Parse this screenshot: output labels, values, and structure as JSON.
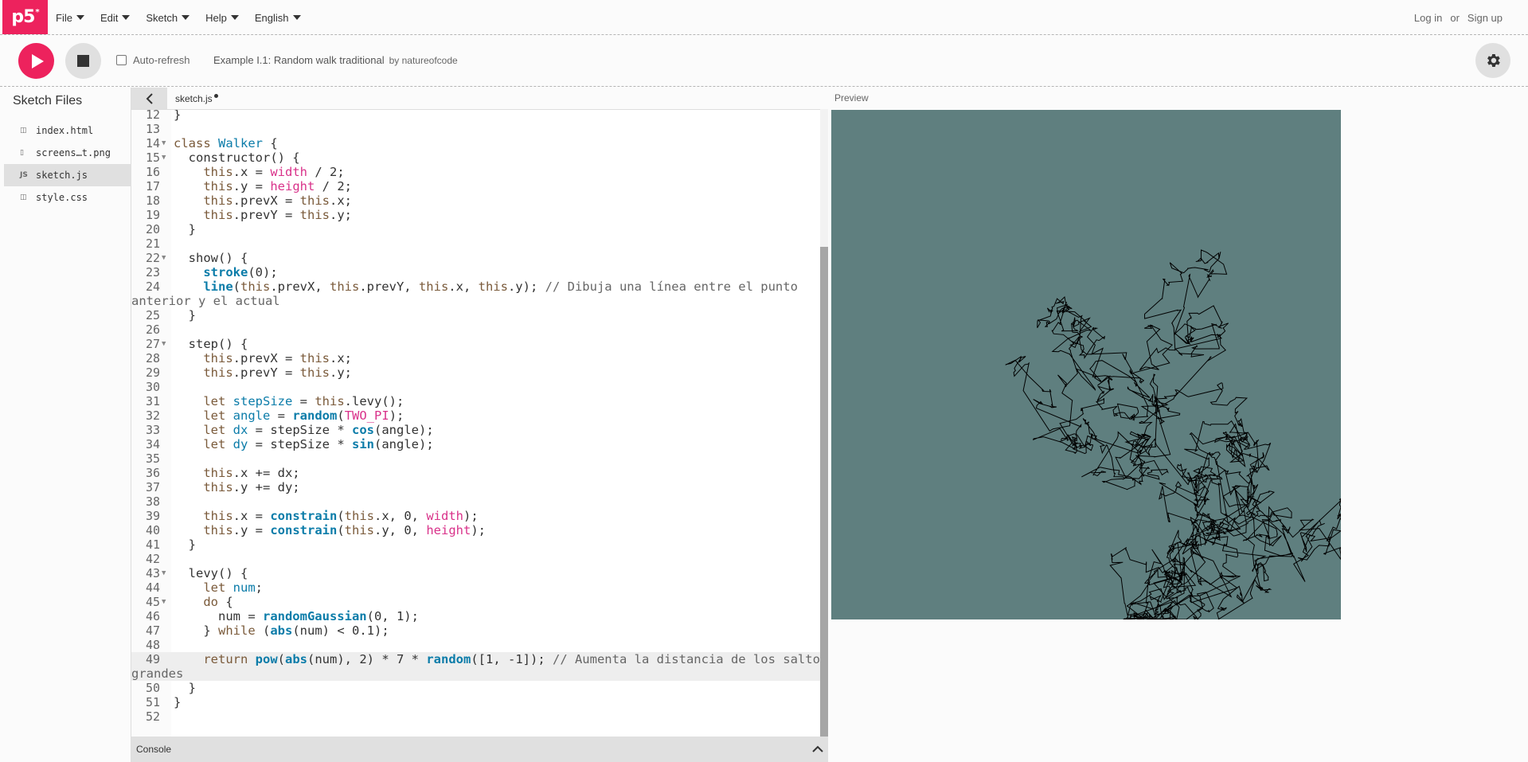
{
  "nav": {
    "logo": "p5",
    "logo_mark": "*",
    "menu": [
      {
        "label": "File"
      },
      {
        "label": "Edit"
      },
      {
        "label": "Sketch"
      },
      {
        "label": "Help"
      },
      {
        "label": "English"
      }
    ],
    "login": "Log in",
    "or": "or",
    "signup": "Sign up"
  },
  "toolbar": {
    "auto_refresh_label": "Auto-refresh",
    "auto_refresh_checked": false,
    "sketch_title": "Example I.1: Random walk traditional",
    "sketch_author": "by natureofcode"
  },
  "sidebar": {
    "title": "Sketch Files",
    "files": [
      {
        "name": "index.html",
        "icon": "html-file-icon",
        "glyph": "◫"
      },
      {
        "name": "screens…t.png",
        "icon": "image-file-icon",
        "glyph": "▯"
      },
      {
        "name": "sketch.js",
        "icon": "js-file-icon",
        "glyph": "JS",
        "active": true
      },
      {
        "name": "style.css",
        "icon": "css-file-icon",
        "glyph": "◫"
      }
    ]
  },
  "editor": {
    "tab": "sketch.js",
    "lines": [
      {
        "n": "12",
        "fold": "",
        "html": "}"
      },
      {
        "n": "13",
        "fold": "",
        "html": ""
      },
      {
        "n": "14",
        "fold": "▼",
        "html": "<span class='kw2'>class</span> <span class='cls'>Walker</span> {"
      },
      {
        "n": "15",
        "fold": "▼",
        "html": "  constructor() {"
      },
      {
        "n": "16",
        "fold": "",
        "html": "    <span class='th'>this</span>.x = <span class='p5v'>width</span> / 2;"
      },
      {
        "n": "17",
        "fold": "",
        "html": "    <span class='th'>this</span>.y = <span class='p5v'>height</span> / 2;"
      },
      {
        "n": "18",
        "fold": "",
        "html": "    <span class='th'>this</span>.prevX = <span class='th'>this</span>.x;"
      },
      {
        "n": "19",
        "fold": "",
        "html": "    <span class='th'>this</span>.prevY = <span class='th'>this</span>.y;"
      },
      {
        "n": "20",
        "fold": "",
        "html": "  }"
      },
      {
        "n": "21",
        "fold": "",
        "html": ""
      },
      {
        "n": "22",
        "fold": "▼",
        "html": "  show() {"
      },
      {
        "n": "23",
        "fold": "",
        "html": "    <span class='fn'>stroke</span>(0);"
      },
      {
        "n": "24",
        "fold": "",
        "html": "    <span class='fn'>line</span>(<span class='th'>this</span>.prevX, <span class='th'>this</span>.prevY, <span class='th'>this</span>.x, <span class='th'>this</span>.y); <span class='cm'>// Dibuja una línea entre el punto</span>"
      },
      {
        "n": "",
        "fold": "",
        "html": "<span class='cm' style='margin-left:-53px'>anterior y el actual</span>"
      },
      {
        "n": "25",
        "fold": "",
        "html": "  }"
      },
      {
        "n": "26",
        "fold": "",
        "html": ""
      },
      {
        "n": "27",
        "fold": "▼",
        "html": "  step() {"
      },
      {
        "n": "28",
        "fold": "",
        "html": "    <span class='th'>this</span>.prevX = <span class='th'>this</span>.x;"
      },
      {
        "n": "29",
        "fold": "",
        "html": "    <span class='th'>this</span>.prevY = <span class='th'>this</span>.y;"
      },
      {
        "n": "30",
        "fold": "",
        "html": ""
      },
      {
        "n": "31",
        "fold": "",
        "html": "    <span class='th'>let</span> <span class='var'>stepSize</span> = <span class='th'>this</span>.levy();"
      },
      {
        "n": "32",
        "fold": "",
        "html": "    <span class='th'>let</span> <span class='var'>angle</span> = <span class='fn'>random</span>(<span class='p5v'>TWO_PI</span>);"
      },
      {
        "n": "33",
        "fold": "",
        "html": "    <span class='th'>let</span> <span class='var'>dx</span> = stepSize * <span class='fn'>cos</span>(angle);"
      },
      {
        "n": "34",
        "fold": "",
        "html": "    <span class='th'>let</span> <span class='var'>dy</span> = stepSize * <span class='fn'>sin</span>(angle);"
      },
      {
        "n": "35",
        "fold": "",
        "html": ""
      },
      {
        "n": "36",
        "fold": "",
        "html": "    <span class='th'>this</span>.x += dx;"
      },
      {
        "n": "37",
        "fold": "",
        "html": "    <span class='th'>this</span>.y += dy;"
      },
      {
        "n": "38",
        "fold": "",
        "html": ""
      },
      {
        "n": "39",
        "fold": "",
        "html": "    <span class='th'>this</span>.x = <span class='fn'>constrain</span>(<span class='th'>this</span>.x, 0, <span class='p5v'>width</span>);"
      },
      {
        "n": "40",
        "fold": "",
        "html": "    <span class='th'>this</span>.y = <span class='fn'>constrain</span>(<span class='th'>this</span>.y, 0, <span class='p5v'>height</span>);"
      },
      {
        "n": "41",
        "fold": "",
        "html": "  }"
      },
      {
        "n": "42",
        "fold": "",
        "html": ""
      },
      {
        "n": "43",
        "fold": "▼",
        "html": "  levy() {"
      },
      {
        "n": "44",
        "fold": "",
        "html": "    <span class='th'>let</span> <span class='var'>num</span>;"
      },
      {
        "n": "45",
        "fold": "▼",
        "html": "    <span class='th'>do</span> {"
      },
      {
        "n": "46",
        "fold": "",
        "html": "      num = <span class='fn'>randomGaussian</span>(0, 1);"
      },
      {
        "n": "47",
        "fold": "",
        "html": "    } <span class='th'>while</span> (<span class='fn'>abs</span>(num) &lt; 0.1);"
      },
      {
        "n": "48",
        "fold": "",
        "html": ""
      },
      {
        "n": "49",
        "fold": "",
        "hl": true,
        "html": "    <span class='th'>return</span> <span class='fn'>pow</span>(<span class='fn'>abs</span>(num), 2) * 7 * <span class='fn'>random</span>([1, -1]); <span class='cm'>// Aumenta la distancia de los saltos</span>"
      },
      {
        "n": "",
        "fold": "",
        "hl": true,
        "html": "<span class='cm' style='margin-left:-53px'>grandes</span>"
      },
      {
        "n": "50",
        "fold": "",
        "html": "  }"
      },
      {
        "n": "51",
        "fold": "",
        "html": "}"
      },
      {
        "n": "52",
        "fold": "",
        "html": ""
      }
    ]
  },
  "console": {
    "label": "Console"
  },
  "preview": {
    "label": "Preview",
    "background": "#5f7f7f",
    "stroke": "#000000"
  },
  "colors": {
    "accent": "#ed225d",
    "button_gray": "#e0e0e0"
  }
}
